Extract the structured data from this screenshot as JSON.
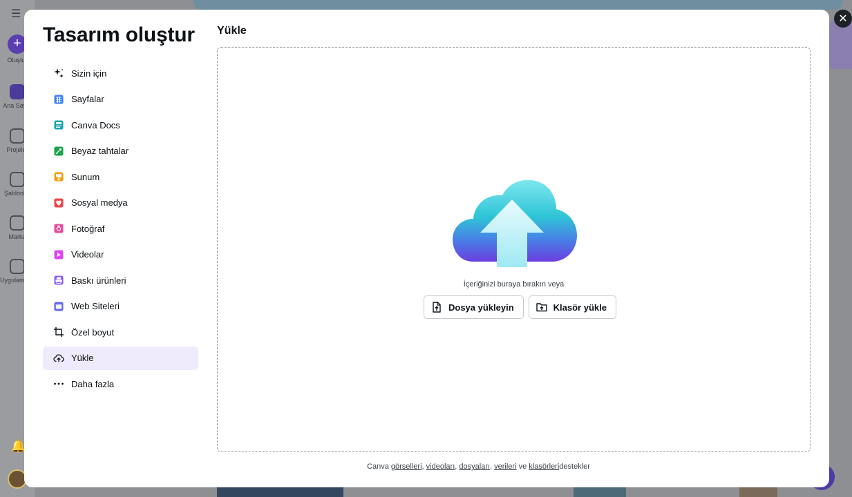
{
  "background": {
    "sidebar": [
      {
        "label": "Oluştur",
        "icon": "plus-icon"
      },
      {
        "label": "Ana Sayfa",
        "icon": "home-icon"
      },
      {
        "label": "Projeler",
        "icon": "folder-icon"
      },
      {
        "label": "Şablonlar",
        "icon": "template-icon"
      },
      {
        "label": "Marka",
        "icon": "brand-icon"
      },
      {
        "label": "Uygulamalar",
        "icon": "apps-icon"
      }
    ]
  },
  "modal": {
    "title": "Tasarım oluştur",
    "close_symbol": "✕",
    "nav": [
      {
        "label": "Sizin için",
        "icon": "sparkle-icon",
        "color": "#0d1216"
      },
      {
        "label": "Sayfalar",
        "icon": "table-icon",
        "color": "#3b82f6"
      },
      {
        "label": "Canva Docs",
        "icon": "docs-icon",
        "color": "#13a3b5"
      },
      {
        "label": "Beyaz tahtalar",
        "icon": "whiteboard-icon",
        "color": "#16a34a"
      },
      {
        "label": "Sunum",
        "icon": "presentation-icon",
        "color": "#f59e0b"
      },
      {
        "label": "Sosyal medya",
        "icon": "heart-icon",
        "color": "#ef4444"
      },
      {
        "label": "Fotoğraf",
        "icon": "camera-icon",
        "color": "#ec4899"
      },
      {
        "label": "Videolar",
        "icon": "video-icon",
        "color": "#d946ef"
      },
      {
        "label": "Baskı ürünleri",
        "icon": "printer-icon",
        "color": "#8b5cf6"
      },
      {
        "label": "Web Siteleri",
        "icon": "website-icon",
        "color": "#6366f1"
      },
      {
        "label": "Özel boyut",
        "icon": "crop-icon",
        "color": "#0d1216"
      },
      {
        "label": "Yükle",
        "icon": "cloud-upload-icon",
        "color": "#0d1216"
      },
      {
        "label": "Daha fazla",
        "icon": "more-icon",
        "color": "#0d1216"
      }
    ],
    "active_nav": "Yükle",
    "upload": {
      "heading": "Yükle",
      "drop_text": "İçeriğinizi buraya bırakın veya",
      "file_button": "Dosya yükleyin",
      "folder_button": "Klasör yükle",
      "support": {
        "prefix": "Canva ",
        "links": [
          "görselleri",
          "videoları",
          "dosyaları",
          "verileri",
          "klasörleri"
        ],
        "separator": ", ",
        "conjunction": " ve ",
        "suffix": "destekler"
      }
    }
  }
}
